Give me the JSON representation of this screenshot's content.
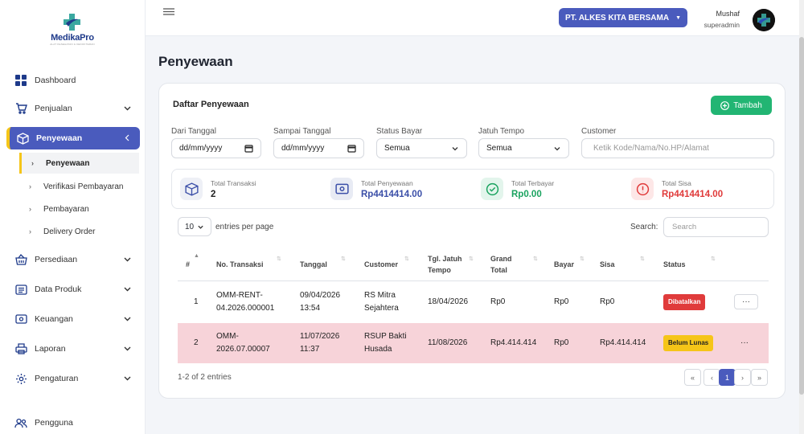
{
  "app": {
    "logo_text": "MedikaPro",
    "logo_sub": "ALAT KESEHATAN & KEDOKTERAN"
  },
  "sidebar": {
    "items": [
      {
        "label": "Dashboard",
        "icon": "grid-icon"
      },
      {
        "label": "Penjualan",
        "icon": "cart-icon"
      },
      {
        "label": "Penyewaan",
        "icon": "box-icon"
      },
      {
        "label": "Persediaan",
        "icon": "basket-icon"
      },
      {
        "label": "Data Produk",
        "icon": "list-icon"
      },
      {
        "label": "Keuangan",
        "icon": "wallet-icon"
      },
      {
        "label": "Laporan",
        "icon": "printer-icon"
      },
      {
        "label": "Pengaturan",
        "icon": "gear-icon"
      },
      {
        "label": "Pengguna",
        "icon": "users-icon"
      }
    ],
    "subitems": [
      {
        "label": "Penyewaan"
      },
      {
        "label": "Verifikasi Pembayaran"
      },
      {
        "label": "Pembayaran"
      },
      {
        "label": "Delivery Order"
      }
    ]
  },
  "topbar": {
    "company": "PT. ALKES KITA BERSAMA",
    "user_name": "Mushaf",
    "user_role": "superadmin"
  },
  "page": {
    "title": "Penyewaan"
  },
  "card": {
    "title": "Daftar Penyewaan",
    "add_label": "Tambah",
    "filters": {
      "from_label": "Dari Tanggal",
      "from_value": "dd/mm/yyyy",
      "to_label": "Sampai Tanggal",
      "to_value": "dd/mm/yyyy",
      "status_label": "Status Bayar",
      "status_value": "Semua",
      "due_label": "Jatuh Tempo",
      "due_value": "Semua",
      "customer_label": "Customer",
      "customer_placeholder": "Ketik Kode/Nama/No.HP/Alamat"
    },
    "summary": [
      {
        "label": "Total Transaksi",
        "value": "2",
        "color": "#222222"
      },
      {
        "label": "Total Penyewaan",
        "value": "Rp4414414.00",
        "color": "#3b4fa8"
      },
      {
        "label": "Total Terbayar",
        "value": "Rp0.00",
        "color": "#1aa35f"
      },
      {
        "label": "Total Sisa",
        "value": "Rp4414414.00",
        "color": "#e03b3b"
      }
    ],
    "table": {
      "page_size": "10",
      "entries_label": "entries per page",
      "search_label": "Search:",
      "search_placeholder": "Search",
      "headers": {
        "no": "#",
        "trx": "No. Transaksi",
        "date": "Tanggal",
        "customer": "Customer",
        "due_1": "Tgl. Jatuh",
        "due_2": "Tempo",
        "grand_1": "Grand",
        "grand_2": "Total",
        "paid": "Bayar",
        "rest": "Sisa",
        "status": "Status"
      },
      "rows": [
        {
          "no": "1",
          "trx_1": "OMM-RENT-",
          "trx_2": "04.2026.000001",
          "date_1": "09/04/2026",
          "date_2": "13:54",
          "cust_1": "RS Mitra",
          "cust_2": "Sejahtera",
          "due": "18/04/2026",
          "grand": "Rp0",
          "paid": "Rp0",
          "rest": "Rp0",
          "status": "Dibatalkan"
        },
        {
          "no": "2",
          "trx_1": "OMM-",
          "trx_2": "2026.07.00007",
          "date_1": "11/07/2026",
          "date_2": "11:37",
          "cust_1": "RSUP Bakti",
          "cust_2": "Husada",
          "due": "11/08/2026",
          "grand": "Rp4.414.414",
          "paid": "Rp0",
          "rest": "Rp4.414.414",
          "status": "Belum Lunas"
        }
      ],
      "info": "1-2 of 2 entries",
      "pagination": {
        "first": "«",
        "prev": "‹",
        "current": "1",
        "next": "›",
        "last": "»"
      }
    }
  }
}
